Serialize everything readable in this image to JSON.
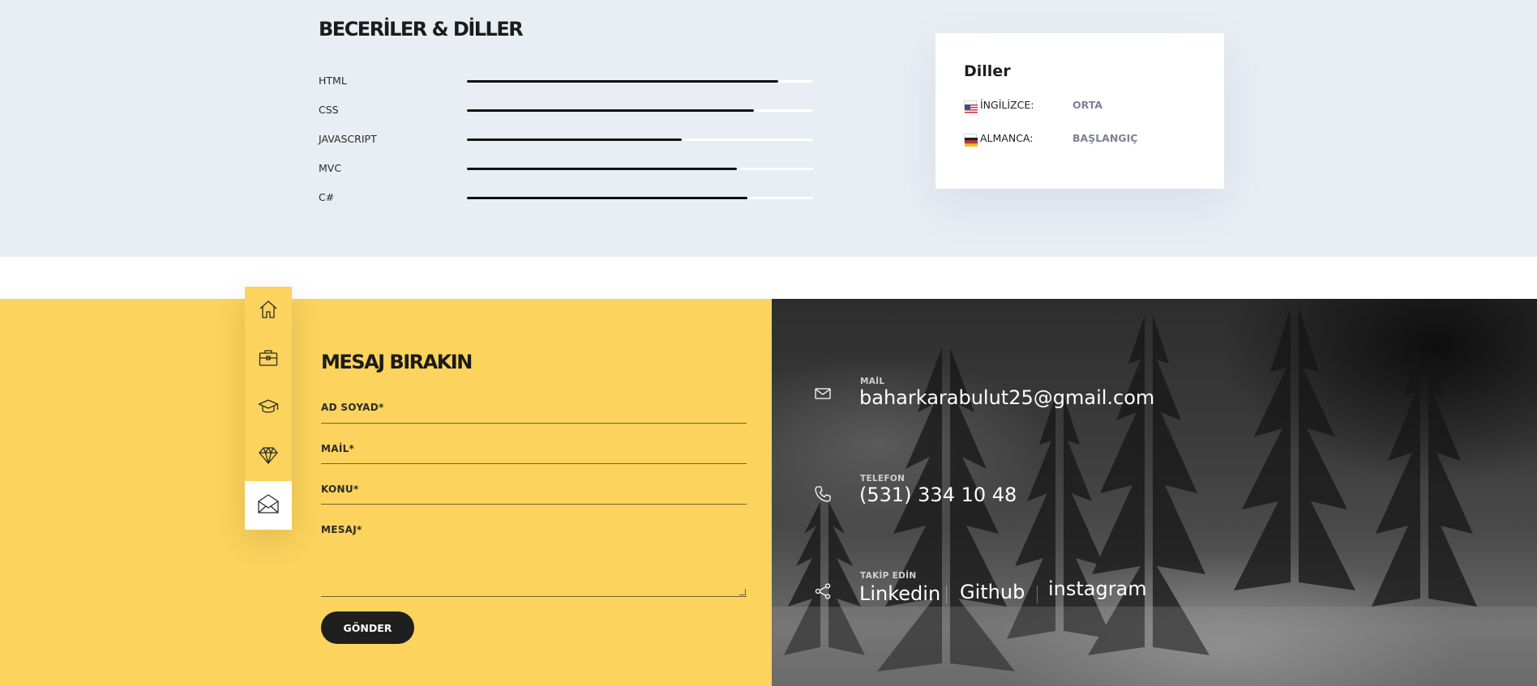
{
  "skills": {
    "title": "BECERİLER & DİLLER",
    "items": [
      {
        "label": "HTML",
        "level": 0.9
      },
      {
        "label": "CSS",
        "level": 0.83
      },
      {
        "label": "JAVASCRIPT",
        "level": 0.62
      },
      {
        "label": "MVC",
        "level": 0.78
      },
      {
        "label": "C#",
        "level": 0.81
      }
    ]
  },
  "languages": {
    "title": "Diller",
    "items": [
      {
        "name": "İNGİLİZCE:",
        "level": "ORTA",
        "flag": "us-flag"
      },
      {
        "name": "ALMANCA:",
        "level": "BAŞLANGIÇ",
        "flag": "de-flag"
      }
    ]
  },
  "nav": {
    "items": [
      {
        "icon": "home-icon",
        "active": false
      },
      {
        "icon": "briefcase-icon",
        "active": false
      },
      {
        "icon": "graduation-cap-icon",
        "active": false
      },
      {
        "icon": "diamond-icon",
        "active": false
      },
      {
        "icon": "envelope-open-icon",
        "active": true
      }
    ]
  },
  "form": {
    "title": "MESAJ BIRAKIN",
    "name_label": "AD SOYAD*",
    "mail_label": "MAİL*",
    "subject_label": "KONU*",
    "message_label": "MESAJ*",
    "submit_label": "GÖNDER"
  },
  "contact": {
    "mail_label": "MAİL",
    "mail_value": "baharkarabulut25@gmail.com",
    "phone_label": "TELEFON",
    "phone_value": "(531) 334 10 48",
    "social_label": "TAKİP EDİN",
    "social_links": [
      "Linkedin",
      "Github",
      "instagram"
    ]
  },
  "colors": {
    "skills_bg": "#e9edf4",
    "accent_yellow": "#fcd35c",
    "dark": "#1f1f1f",
    "lang_level": "#7c8298"
  }
}
